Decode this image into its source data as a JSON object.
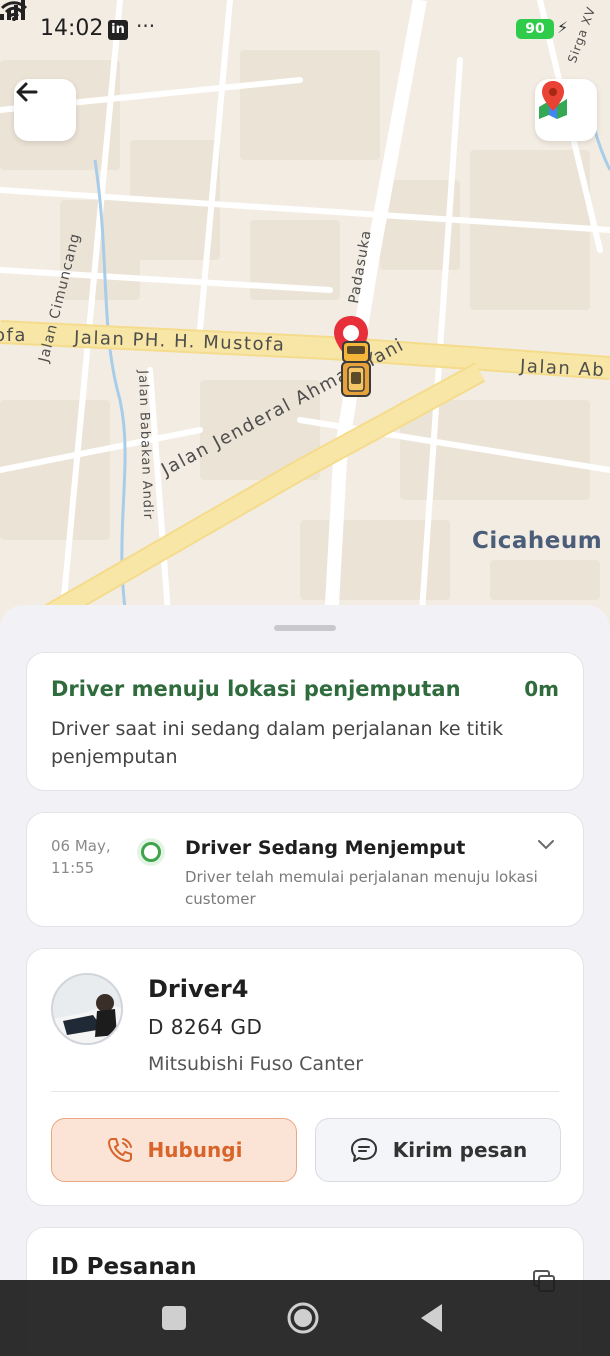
{
  "status_bar": {
    "time": "14:02",
    "linkedin_badge": "in",
    "more": "···",
    "battery": "90",
    "icons": [
      "signal-icon",
      "wifi-icon",
      "battery-icon",
      "charging-icon"
    ]
  },
  "map": {
    "labels": {
      "mustofa": "Jalan PH. H. Mustofa",
      "mustofa_left": "ofa",
      "jalan_ab": "Jalan Ab",
      "ahmad_yani": "Jalan Jenderal Ahmad Yani",
      "cimuncang": "Jalan Cimuncang",
      "babakan": "Jalan Babakan Andir",
      "padasuka": "Padasuka",
      "sirga": "Sirga XV",
      "cicaheum": "Cicaheum"
    },
    "colors": {
      "pin": "#e8303a",
      "background": "#f3ece2",
      "main_road": "#f7e6a6"
    }
  },
  "status_card": {
    "title": "Driver menuju lokasi penjemputan",
    "eta": "0m",
    "description": "Driver saat ini sedang dalam perjalanan ke titik penjemputan"
  },
  "timeline": {
    "date": "06 May,",
    "time": "11:55",
    "title": "Driver Sedang Menjemput",
    "description": "Driver telah memulai perjalanan menuju lokasi customer"
  },
  "driver": {
    "name": "Driver4",
    "plate": "D 8264 GD",
    "vehicle": "Mitsubishi Fuso Canter",
    "call_label": "Hubungi",
    "message_label": "Kirim pesan"
  },
  "order": {
    "title": "ID Pesanan"
  },
  "colors": {
    "accent_green": "#2f6b3c",
    "call_orange": "#d8642a",
    "call_bg": "#fbe4d6"
  }
}
